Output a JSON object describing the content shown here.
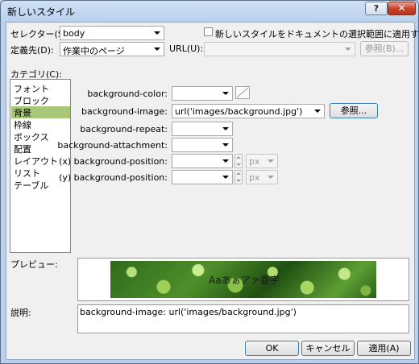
{
  "window": {
    "title": "新しいスタイル",
    "help_glyph": "?",
    "close_glyph": "✕"
  },
  "selector": {
    "label": "セレクター(S):",
    "value": "body"
  },
  "apply_new_style_checkbox": {
    "label": "新しいスタイルをドキュメントの選択範囲に適用する(P)",
    "checked": false
  },
  "define_in": {
    "label": "定義先(D):",
    "value": "作業中のページ"
  },
  "url": {
    "label": "URL(U):",
    "value": "",
    "browse_label": "参照(B)..."
  },
  "category": {
    "label": "カテゴリ(C):",
    "items": [
      "フォント",
      "ブロック",
      "背景",
      "枠線",
      "ボックス",
      "配置",
      "レイアウト",
      "リスト",
      "テーブル"
    ],
    "selected": "背景"
  },
  "properties": {
    "color_label": "background-color:",
    "image_label": "background-image:",
    "image_value": "url('images/background.jpg')",
    "image_browse_label": "参照...",
    "repeat_label": "background-repeat:",
    "attachment_label": "background-attachment:",
    "pos_x_label": "(x) background-position:",
    "pos_y_label": "(y) background-position:",
    "unit_placeholder": "px"
  },
  "preview": {
    "label": "プレビュー:",
    "sample_text": "Aaあぁアァ亜宇"
  },
  "description": {
    "label": "説明:",
    "text": "background-image: url('images/background.jpg')"
  },
  "buttons": {
    "ok": "OK",
    "cancel": "キャンセル",
    "apply": "適用(A)"
  },
  "colors": {
    "selection": "#a8c878",
    "title_bar": "#b9d1ee",
    "close_button": "#c7442b"
  }
}
